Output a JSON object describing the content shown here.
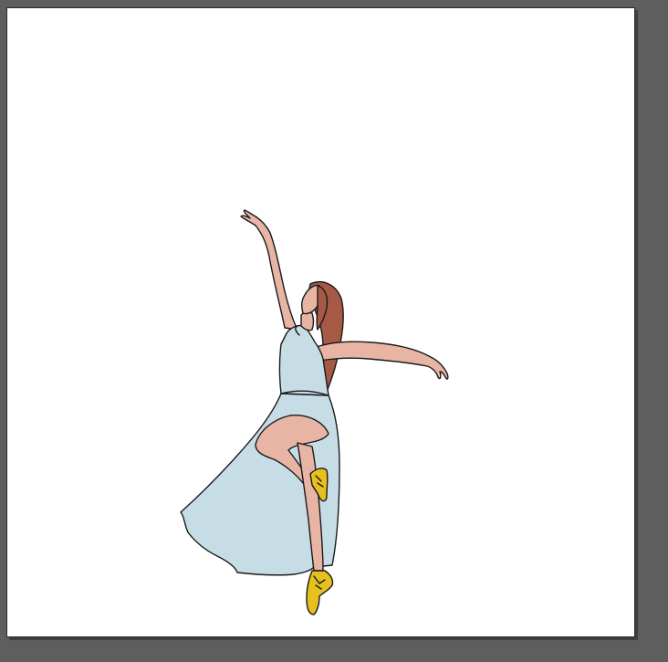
{
  "canvas": {
    "pasteboard_color": "#5e5e5e",
    "artboard_color": "#ffffff"
  },
  "illustration": {
    "subject_icon": "ballerina-illustration",
    "colors": {
      "dress": "#c7dde6",
      "skin": "#e8b4a3",
      "hair": "#a65945",
      "shoes": "#e5c01e",
      "outline": "#1a1a1a"
    }
  }
}
